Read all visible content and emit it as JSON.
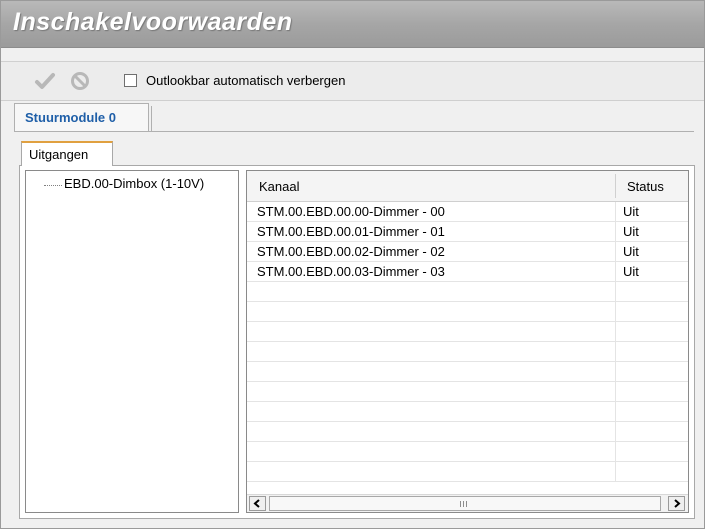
{
  "window": {
    "title": "Inschakelvoorwaarden"
  },
  "toolbar": {
    "confirm_icon": "checkmark-icon",
    "cancel_icon": "cancel-icon",
    "checkbox_label": "Outlookbar automatisch verbergen",
    "checkbox_checked": false
  },
  "tabs": {
    "module_tab": "Stuurmodule 0",
    "sub_tab": "Uitgangen"
  },
  "tree": {
    "items": [
      {
        "label": "EBD.00-Dimbox (1-10V)"
      }
    ]
  },
  "grid": {
    "columns": [
      "Kanaal",
      "Status"
    ],
    "rows": [
      {
        "kanaal": "STM.00.EBD.00.00-Dimmer - 00",
        "status": "Uit"
      },
      {
        "kanaal": "STM.00.EBD.00.01-Dimmer - 01",
        "status": "Uit"
      },
      {
        "kanaal": "STM.00.EBD.00.02-Dimmer - 02",
        "status": "Uit"
      },
      {
        "kanaal": "STM.00.EBD.00.03-Dimmer - 03",
        "status": "Uit"
      }
    ]
  },
  "colors": {
    "title_bar": "#a6a6a6",
    "tab_accent": "#e0a040",
    "tab_text": "#1f5fa8"
  }
}
